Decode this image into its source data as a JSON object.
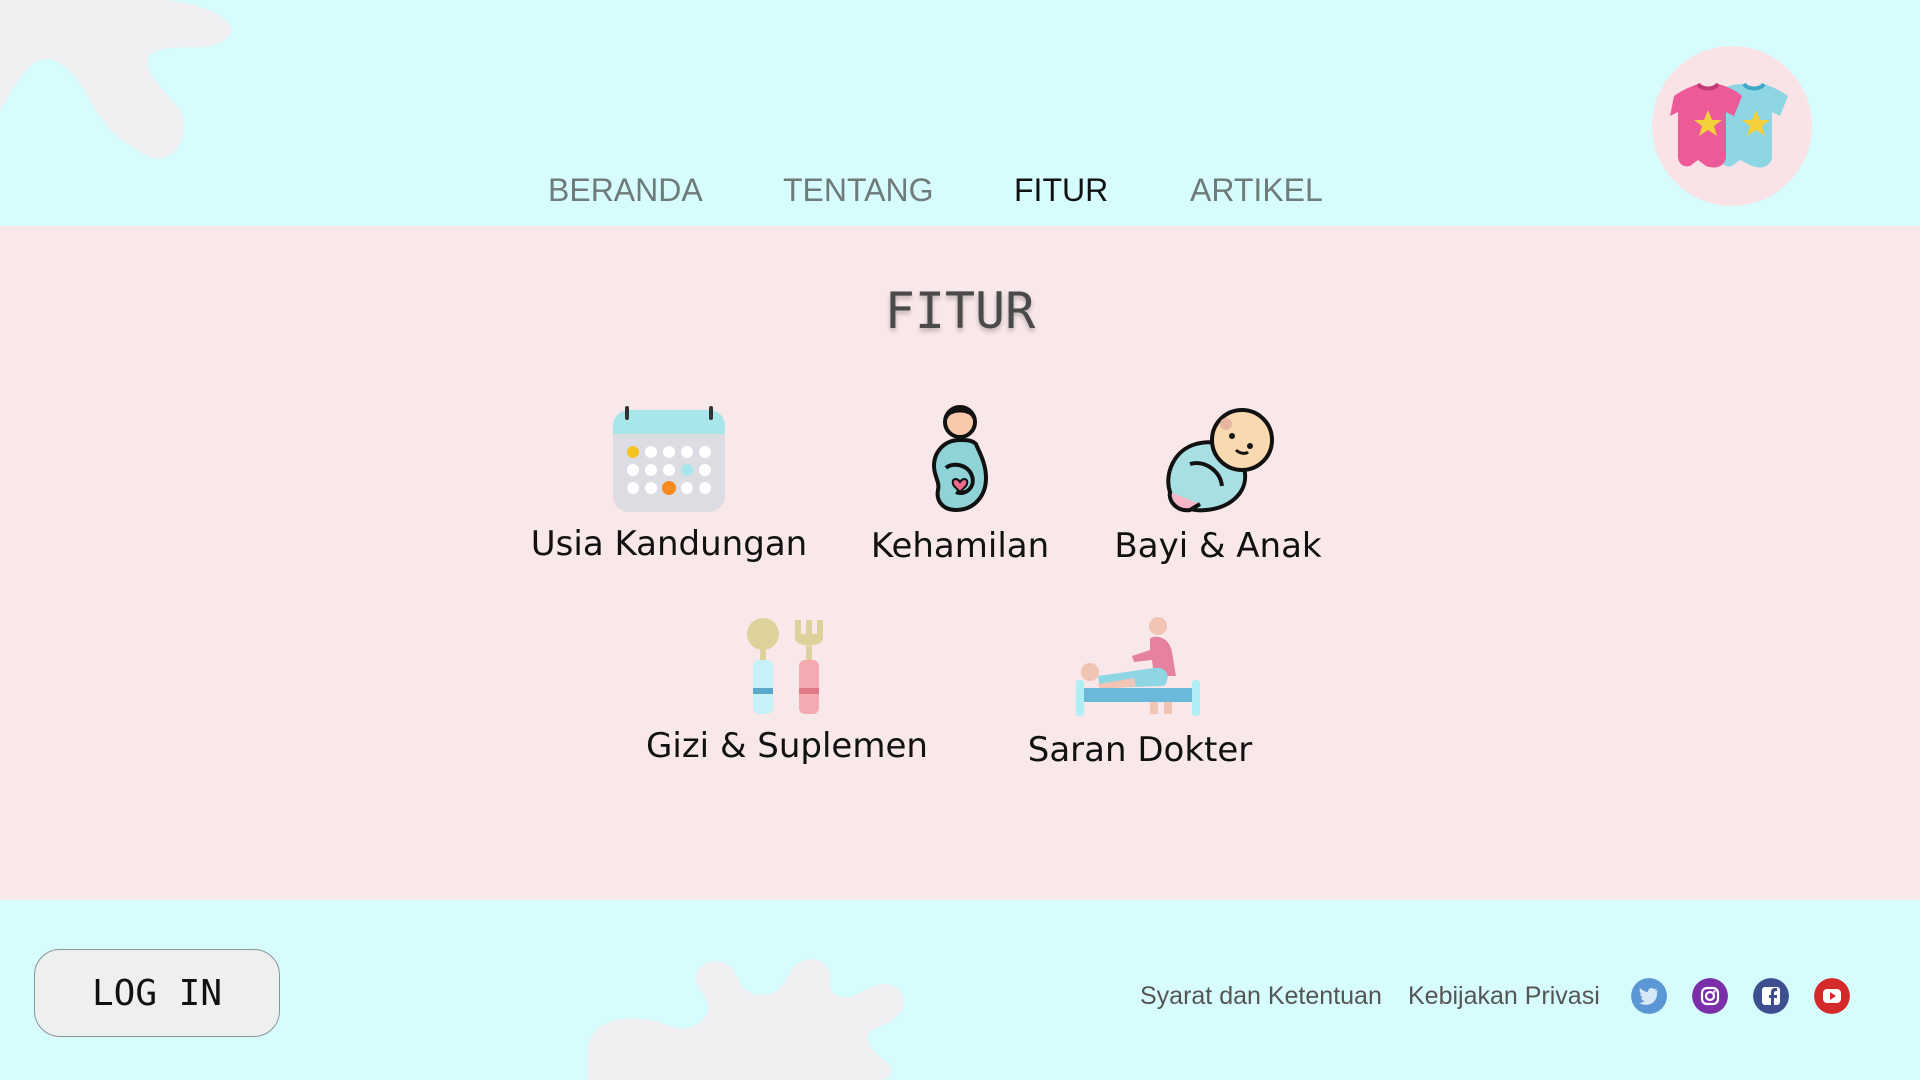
{
  "nav": {
    "items": [
      {
        "label": "BERANDA",
        "active": false
      },
      {
        "label": "TENTANG",
        "active": false
      },
      {
        "label": "FITUR",
        "active": true
      },
      {
        "label": "ARTIKEL",
        "active": false
      }
    ]
  },
  "logo": {
    "icon": "baby-onesies-icon"
  },
  "main": {
    "title": "FITUR",
    "features": [
      {
        "label": "Usia Kandungan",
        "icon": "calendar-icon"
      },
      {
        "label": "Kehamilan",
        "icon": "pregnant-woman-icon"
      },
      {
        "label": "Bayi & Anak",
        "icon": "swaddled-baby-icon"
      },
      {
        "label": "Gizi & Suplemen",
        "icon": "spoon-fork-icon"
      },
      {
        "label": "Saran Dokter",
        "icon": "doctor-examination-icon"
      }
    ]
  },
  "footer": {
    "login_label": "LOG IN",
    "links": [
      "Syarat dan Ketentuan",
      "Kebijakan Privasi"
    ],
    "social": [
      {
        "icon": "twitter-icon",
        "color": "#5b97d4"
      },
      {
        "icon": "instagram-icon",
        "color": "#7a2fa8"
      },
      {
        "icon": "facebook-icon",
        "color": "#3d4f8f"
      },
      {
        "icon": "youtube-icon",
        "color": "#d42a2a"
      }
    ]
  },
  "colors": {
    "header_bg": "#d6fcfe",
    "main_bg": "#f9e8ea",
    "splat": "#f0f0f2"
  }
}
